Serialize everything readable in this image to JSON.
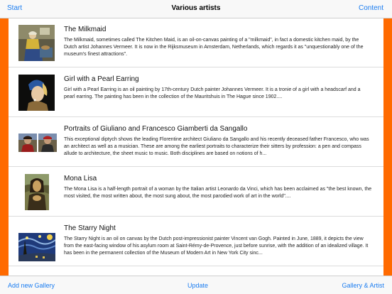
{
  "navbar": {
    "left_label": "Start",
    "title": "Various artists",
    "right_label": "Content"
  },
  "paintings": [
    {
      "title": "The Milkmaid",
      "description": "The Milkmaid, sometimes called The Kitchen Maid, is an oil-on-canvas painting of a \"milkmaid\", in fact a domestic kitchen maid, by the Dutch artist Johannes Vermeer. It is now in the Rijksmuseum in Amsterdam, Netherlands, which regards it as \"unquestionably one of the museum's finest attractions\"."
    },
    {
      "title": "Girl with a Pearl Earring",
      "description": "Girl with a Pearl Earring is an oil painting by 17th-century Dutch painter Johannes Vermeer. It is a tronie of a girl with a headscarf and a pearl earring. The painting has been in the collection of the Mauritshuis in The Hague since 1902...."
    },
    {
      "title": "Portraits of Giuliano and Francesco Giamberti da Sangallo",
      "description": "This exceptional diptych shows the leading Florentine architect Giuliano da Sangallo and his recently deceased father Francesco, who was an architect as well as a musician. These are among the earliest portraits to characterize their sitters by profession: a pen and compass allude to architecture, the sheet music to music. Both disciplines are based on notions of h..."
    },
    {
      "title": "Mona Lisa",
      "description": "The Mona Lisa is a half-length portrait of a woman by the Italian artist Leonardo da Vinci, which has been acclaimed as \"the best known, the most visited, the most written about, the most sung about, the most parodied work of art in the world\"...."
    },
    {
      "title": "The Starry Night",
      "description": "The Starry Night is an oil on canvas by the Dutch post-impressionist painter Vincent van Gogh. Painted in June, 1889, it depicts the view from the east-facing window of his asylum room at Saint-Rémy-de-Provence, just before sunrise, with the addition of an idealized village. It has been in the permanent collection of the Museum of Modern Art in New York City sinc..."
    }
  ],
  "toolbar": {
    "add_label": "Add new Gallery",
    "update_label": "Update",
    "gallery_label": "Gallery & Artist"
  },
  "colors": {
    "accent": "#1a7cf0",
    "sidebar": "#ff6a00"
  }
}
